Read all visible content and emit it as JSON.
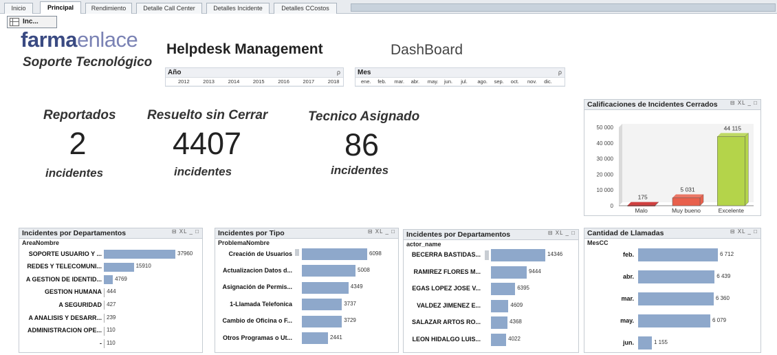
{
  "tabs": [
    "Inicio",
    "Principal",
    "Rendimiento",
    "Detalle Call Center",
    "Detalles Incidente",
    "Detalles CCostos"
  ],
  "inc_button": "Inc...",
  "logo": {
    "part1": "farma",
    "part2": "enlace",
    "subtitle": "Soporte Tecnológico"
  },
  "title": "Helpdesk Management",
  "subtitle": "DashBoard",
  "filters": {
    "year": {
      "label": "Año",
      "search_icon": "ρ",
      "values": [
        "2012",
        "2013",
        "2014",
        "2015",
        "2016",
        "2017",
        "2018"
      ]
    },
    "month": {
      "label": "Mes",
      "search_icon": "ρ",
      "values": [
        "ene.",
        "feb.",
        "mar.",
        "abr.",
        "may.",
        "jun.",
        "jul.",
        "ago.",
        "sep.",
        "oct.",
        "nov.",
        "dic."
      ]
    }
  },
  "kpis": [
    {
      "title": "Reportados",
      "value": "2",
      "unit": "incidentes"
    },
    {
      "title": "Resuelto sin Cerrar",
      "value": "4407",
      "unit": "incidentes"
    },
    {
      "title": "Tecnico Asignado",
      "value": "86",
      "unit": "incidentes"
    }
  ],
  "panel_tools": "⊟ XL _ □",
  "panels": {
    "dept": {
      "title": "Incidentes por Departamentos",
      "dimension": "AreaNombre",
      "rows": [
        {
          "label": "SOPORTE USUARIO Y ...",
          "value": 37960,
          "text": "37960"
        },
        {
          "label": "REDES Y TELECOMUNI...",
          "value": 15910,
          "text": "15910"
        },
        {
          "label": "A GESTION DE IDENTID...",
          "value": 4769,
          "text": "4769"
        },
        {
          "label": "GESTION HUMANA",
          "value": 444,
          "text": "444"
        },
        {
          "label": "A SEGURIDAD",
          "value": 427,
          "text": "427"
        },
        {
          "label": "A ANALISIS Y DESARR...",
          "value": 239,
          "text": "239"
        },
        {
          "label": "ADMINISTRACION OPE...",
          "value": 110,
          "text": "110"
        },
        {
          "label": "-",
          "value": 110,
          "text": "110"
        }
      ]
    },
    "tipo": {
      "title": "Incidentes por Tipo",
      "dimension": "ProblemaNombre",
      "rows": [
        {
          "label": "Creación de Usuarios",
          "value": 6098,
          "text": "6098"
        },
        {
          "label": "Actualizacion Datos d...",
          "value": 5008,
          "text": "5008"
        },
        {
          "label": "Asignación de Permis...",
          "value": 4349,
          "text": "4349"
        },
        {
          "label": "1-Llamada Telefonica",
          "value": 3737,
          "text": "3737"
        },
        {
          "label": "Cambio de Oficina o F...",
          "value": 3729,
          "text": "3729"
        },
        {
          "label": "Otros Programas o Ut...",
          "value": 2441,
          "text": "2441"
        }
      ]
    },
    "actor": {
      "title": "Incidentes por Departamentos",
      "dimension": "actor_name",
      "rows": [
        {
          "label": "BECERRA BASTIDAS...",
          "value": 14346,
          "text": "14346"
        },
        {
          "label": "RAMIREZ FLORES M...",
          "value": 9444,
          "text": "9444"
        },
        {
          "label": "EGAS LOPEZ JOSE V...",
          "value": 6395,
          "text": "6395"
        },
        {
          "label": "VALDEZ JIMENEZ E...",
          "value": 4609,
          "text": "4609"
        },
        {
          "label": "SALAZAR ARTOS RO...",
          "value": 4368,
          "text": "4368"
        },
        {
          "label": "LEON HIDALGO LUIS...",
          "value": 4022,
          "text": "4022"
        }
      ]
    },
    "llamadas": {
      "title": "Cantidad de Llamadas",
      "dimension": "MesCC",
      "rows": [
        {
          "label": "feb.",
          "value": 6712,
          "text": "6 712"
        },
        {
          "label": "abr.",
          "value": 6439,
          "text": "6 439"
        },
        {
          "label": "mar.",
          "value": 6360,
          "text": "6 360"
        },
        {
          "label": "may.",
          "value": 6079,
          "text": "6 079"
        },
        {
          "label": "jun.",
          "value": 1155,
          "text": "1 155"
        }
      ]
    }
  },
  "chart_data": {
    "type": "bar",
    "title": "Calificaciones de Incidentes Cerrados",
    "categories": [
      "Malo",
      "Muy bueno",
      "Excelente"
    ],
    "values": [
      175,
      5031,
      44115
    ],
    "value_labels": [
      "175",
      "5 031",
      "44 115"
    ],
    "colors": [
      "#c81e1e",
      "#e8604c",
      "#b4d44a"
    ],
    "yticks": [
      "0",
      "10 000",
      "20 000",
      "30 000",
      "40 000",
      "50 000"
    ],
    "ylim": [
      0,
      50000
    ]
  }
}
